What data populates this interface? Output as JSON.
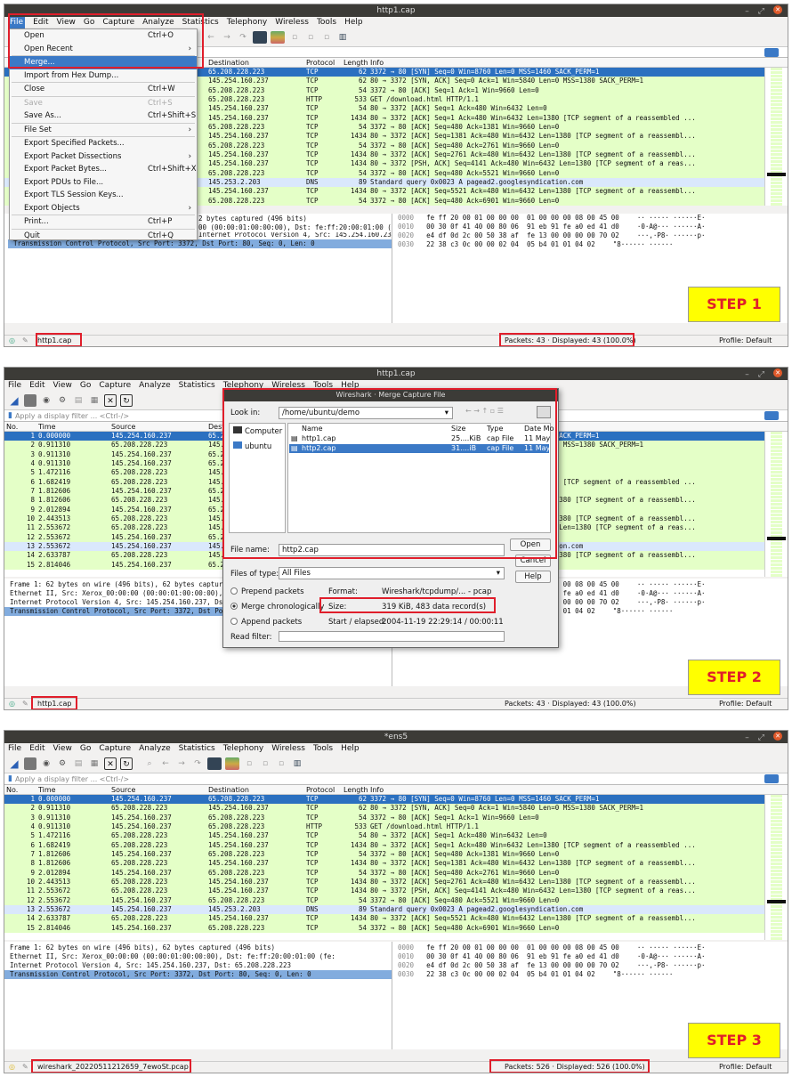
{
  "menubar": [
    "File",
    "Edit",
    "View",
    "Go",
    "Capture",
    "Analyze",
    "Statistics",
    "Telephony",
    "Wireless",
    "Tools",
    "Help"
  ],
  "filter_placeholder": "Apply a display filter ... <Ctrl-/>",
  "columns": [
    "No.",
    "Time",
    "Source",
    "Destination",
    "Protocol",
    "Length",
    "Info"
  ],
  "rows": [
    {
      "no": "1",
      "time": "0.000000",
      "src": "145.254.160.237",
      "dst": "65.208.228.223",
      "proto": "TCP",
      "len": "62",
      "info": "3372 → 80 [SYN] Seq=0 Win=8760 Len=0 MSS=1460 SACK_PERM=1"
    },
    {
      "no": "2",
      "time": "0.911310",
      "src": "65.208.228.223",
      "dst": "145.254.160.237",
      "proto": "TCP",
      "len": "62",
      "info": "80 → 3372 [SYN, ACK] Seq=0 Ack=1 Win=5840 Len=0 MSS=1380 SACK_PERM=1"
    },
    {
      "no": "3",
      "time": "0.911310",
      "src": "145.254.160.237",
      "dst": "65.208.228.223",
      "proto": "TCP",
      "len": "54",
      "info": "3372 → 80 [ACK] Seq=1 Ack=1 Win=9660 Len=0"
    },
    {
      "no": "4",
      "time": "0.911310",
      "src": "145.254.160.237",
      "dst": "65.208.228.223",
      "proto": "HTTP",
      "len": "533",
      "info": "GET /download.html HTTP/1.1"
    },
    {
      "no": "5",
      "time": "1.472116",
      "src": "65.208.228.223",
      "dst": "145.254.160.237",
      "proto": "TCP",
      "len": "54",
      "info": "80 → 3372 [ACK] Seq=1 Ack=480 Win=6432 Len=0"
    },
    {
      "no": "6",
      "time": "1.682419",
      "src": "65.208.228.223",
      "dst": "145.254.160.237",
      "proto": "TCP",
      "len": "1434",
      "info": "80 → 3372 [ACK] Seq=1 Ack=480 Win=6432 Len=1380 [TCP segment of a reassembled ..."
    },
    {
      "no": "7",
      "time": "1.812606",
      "src": "145.254.160.237",
      "dst": "65.208.228.223",
      "proto": "TCP",
      "len": "54",
      "info": "3372 → 80 [ACK] Seq=480 Ack=1381 Win=9660 Len=0"
    },
    {
      "no": "8",
      "time": "1.812606",
      "src": "65.208.228.223",
      "dst": "145.254.160.237",
      "proto": "TCP",
      "len": "1434",
      "info": "80 → 3372 [ACK] Seq=1381 Ack=480 Win=6432 Len=1380 [TCP segment of a reassembl..."
    },
    {
      "no": "9",
      "time": "2.012894",
      "src": "145.254.160.237",
      "dst": "65.208.228.223",
      "proto": "TCP",
      "len": "54",
      "info": "3372 → 80 [ACK] Seq=480 Ack=2761 Win=9660 Len=0"
    },
    {
      "no": "10",
      "time": "2.443513",
      "src": "65.208.228.223",
      "dst": "145.254.160.237",
      "proto": "TCP",
      "len": "1434",
      "info": "80 → 3372 [ACK] Seq=2761 Ack=480 Win=6432 Len=1380 [TCP segment of a reassembl..."
    },
    {
      "no": "11",
      "time": "2.553672",
      "src": "65.208.228.223",
      "dst": "145.254.160.237",
      "proto": "TCP",
      "len": "1434",
      "info": "80 → 3372 [PSH, ACK] Seq=4141 Ack=480 Win=6432 Len=1380 [TCP segment of a reas..."
    },
    {
      "no": "12",
      "time": "2.553672",
      "src": "145.254.160.237",
      "dst": "65.208.228.223",
      "proto": "TCP",
      "len": "54",
      "info": "3372 → 80 [ACK] Seq=480 Ack=5521 Win=9660 Len=0"
    },
    {
      "no": "13",
      "time": "2.553672",
      "src": "145.254.160.237",
      "dst": "145.253.2.203",
      "proto": "DNS",
      "len": "89",
      "info": "Standard query 0x0023 A pagead2.googlesyndication.com"
    },
    {
      "no": "14",
      "time": "2.633787",
      "src": "65.208.228.223",
      "dst": "145.254.160.237",
      "proto": "TCP",
      "len": "1434",
      "info": "80 → 3372 [ACK] Seq=5521 Ack=480 Win=6432 Len=1380 [TCP segment of a reassembl..."
    },
    {
      "no": "15",
      "time": "2.814046",
      "src": "145.254.160.237",
      "dst": "65.208.228.223",
      "proto": "TCP",
      "len": "54",
      "info": "3372 → 80 [ACK] Seq=480 Ack=6901 Win=9660 Len=0"
    }
  ],
  "details": [
    "Frame 1: 62 bytes on wire (496 bits), 62 bytes captured (496 bits)",
    "Ethernet II, Src: Xerox_00:00:00 (00:00:01:00:00:00), Dst: fe:ff:20:00:01:00 (fe:",
    "Internet Protocol Version 4, Src: 145.254.160.237, Dst: 65.208.228.223",
    "Transmission Control Protocol, Src Port: 3372, Dst Port: 80, Seq: 0, Len: 0"
  ],
  "hex": [
    {
      "off": "0000",
      "bytes": "fe ff 20 00 01 00 00 00  01 00 00 00 08 00 45 00",
      "ascii": "·· ····· ······E·"
    },
    {
      "off": "0010",
      "bytes": "00 30 0f 41 40 00 80 06  91 eb 91 fe a0 ed 41 d0",
      "ascii": "·0·A@··· ······A·"
    },
    {
      "off": "0020",
      "bytes": "e4 df 0d 2c 00 50 38 af  fe 13 00 00 00 00 70 02",
      "ascii": "···,·P8· ······p·"
    },
    {
      "off": "0030",
      "bytes": "22 38 c3 0c 00 00 02 04  05 b4 01 01 04 02",
      "ascii": "\"8······ ······"
    }
  ],
  "p1": {
    "title": "http1.cap",
    "details_visible": [
      "2 bytes captured (496 bits)",
      "00 (00:00:01:00:00:00), Dst: fe:ff:20:00:01:00 (fe:",
      "Internet Protocol Version 4, Src: 145.254.160.237, Dst: 65.208.228.223"
    ],
    "status_file": "http1.cap",
    "status_packets": "Packets: 43 · Displayed: 43 (100.0%)",
    "status_profile": "Profile: Default",
    "step": "STEP 1",
    "menu": [
      {
        "label": "Open",
        "sc": "Ctrl+O"
      },
      {
        "label": "Open Recent",
        "arrow": "›"
      },
      {
        "label": "Merge..."
      },
      {
        "label": "Import from Hex Dump..."
      },
      {
        "label": "Close",
        "sc": "Ctrl+W"
      },
      {
        "label": "Save",
        "sc": "Ctrl+S",
        "dis": true
      },
      {
        "label": "Save As...",
        "sc": "Ctrl+Shift+S"
      },
      {
        "label": "File Set",
        "arrow": "›"
      },
      {
        "label": "Export Specified Packets..."
      },
      {
        "label": "Export Packet Dissections",
        "arrow": "›"
      },
      {
        "label": "Export Packet Bytes...",
        "sc": "Ctrl+Shift+X"
      },
      {
        "label": "Export PDUs to File..."
      },
      {
        "label": "Export TLS Session Keys..."
      },
      {
        "label": "Export Objects",
        "arrow": "›"
      },
      {
        "label": "Print...",
        "sc": "Ctrl+P"
      },
      {
        "label": "Quit",
        "sc": "Ctrl+Q"
      }
    ]
  },
  "p2": {
    "title": "http1.cap",
    "status_file": "http1.cap",
    "status_packets": "Packets: 43 · Displayed: 43 (100.0%)",
    "status_profile": "Profile: Default",
    "step": "STEP 2",
    "dialog": {
      "title": "Wireshark · Merge Capture File",
      "look_in_label": "Look in:",
      "look_in": "/home/ubuntu/demo",
      "sidebar": [
        "Computer",
        "ubuntu"
      ],
      "cols": [
        "Name",
        "Size",
        "Type",
        "Date Mo"
      ],
      "files": [
        {
          "name": "http1.cap",
          "size": "25....KiB",
          "type": "cap File",
          "date": "11 May"
        },
        {
          "name": "http2.cap",
          "size": "31....iB",
          "type": "cap File",
          "date": "11 May"
        }
      ],
      "file_name_label": "File name:",
      "file_name": "http2.cap",
      "files_of_type_label": "Files of type:",
      "files_of_type": "All Files",
      "open": "Open",
      "cancel": "Cancel",
      "help": "Help",
      "radios": [
        "Prepend packets",
        "Merge chronologically",
        "Append packets"
      ],
      "format_label": "Format:",
      "format": "Wireshark/tcpdump/... - pcap",
      "size_label": "Size:",
      "size": "319 KiB, 483 data record(s)",
      "start_label": "Start / elapsed:",
      "start": "2004-11-19 22:29:14 / 00:00:11",
      "read_filter_label": "Read filter:"
    }
  },
  "p3": {
    "title": "*ens5",
    "status_file": "wireshark_20220511212659_7ewoSt.pcap",
    "status_packets": "Packets: 526 · Displayed: 526 (100.0%)",
    "status_profile": "Profile: Default",
    "step": "STEP 3"
  }
}
